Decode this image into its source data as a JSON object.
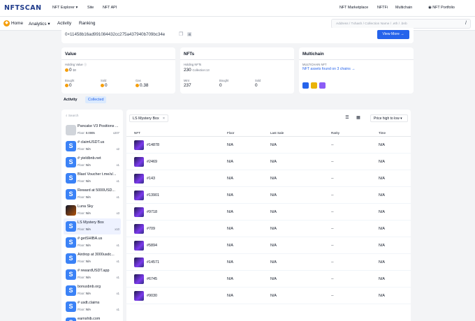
{
  "brand": {
    "logo": "NFTSCAN"
  },
  "topnav": {
    "nft_explorer": "NFT Explorer",
    "site": "Site",
    "nft_api": "NFT API",
    "marketplace": "NFT Marketplace",
    "nftfi": "NFTFi",
    "multichain": "Multichain",
    "portfolio": "NFT Portfolio"
  },
  "subnav": {
    "home": "Home",
    "analytics": "Analytics",
    "activity": "Activity",
    "ranking": "Ranking",
    "search_placeholder": "Address / Txhash / Collection Name / .eth / .bnb",
    "search_slash": "/"
  },
  "address": {
    "value": "0×11458b16ad991084432cc275a437940b709bc34e",
    "view_more": "View More →"
  },
  "value_card": {
    "title": "Value",
    "holding_label": "Holding Value",
    "holding_value": "0",
    "holding_usd": "$0",
    "bought_label": "Bought",
    "bought_value": "0",
    "sold_label": "Sold",
    "sold_value": "0",
    "gas_label": "Gas",
    "gas_value": "0.38"
  },
  "nfts_card": {
    "title": "NFTs",
    "holding_label": "Holding NFTs",
    "holding_count": "230",
    "holding_collections": "Collection:13",
    "mint_label": "Mint",
    "mint_value": "237",
    "bought_label": "Bought",
    "bought_value": "0",
    "sold_label": "Sold",
    "sold_value": "0"
  },
  "multichain_card": {
    "title": "Multichain",
    "label": "MULTICHAIN NFT",
    "link": "NFT assets found on 3 chains →",
    "chain_colors": [
      "#2563eb",
      "#eab308",
      "#8b5cf6"
    ]
  },
  "tabs": {
    "activity": "Activity",
    "collected": "Collected"
  },
  "collections": {
    "search_placeholder": "Search",
    "items": [
      {
        "name": "Pancake V3 Positions ...",
        "floor_label": "Floor:",
        "floor": "0.0005",
        "count": "x207",
        "icon": "image"
      },
      {
        "name": "# claimUSDT.us",
        "floor_label": "Floor:",
        "floor": "N/A",
        "count": "x2",
        "icon": "S"
      },
      {
        "name": "# yieldbnb.net",
        "floor_label": "Floor:",
        "floor": "N/A",
        "count": "x1",
        "icon": "S"
      },
      {
        "name": "Blast Voucher t.me/s/...",
        "floor_label": "Floor:",
        "floor": "N/A",
        "count": "x1",
        "icon": "S"
      },
      {
        "name": "Reward at 5000USD...",
        "floor_label": "Floor:",
        "floor": "N/A",
        "count": "x1",
        "icon": "S"
      },
      {
        "name": "Luna Sky",
        "floor_label": "Floor:",
        "floor": "N/A",
        "count": "x3",
        "icon": "image"
      },
      {
        "name": "LS Mystery Box",
        "floor_label": "Floor:",
        "floor": "N/A",
        "count": "x10",
        "icon": "S"
      },
      {
        "name": "# getSHIBA.us",
        "floor_label": "Floor:",
        "floor": "N/A",
        "count": "x1",
        "icon": "S"
      },
      {
        "name": "Airdrop at 3000usdc...",
        "floor_label": "Floor:",
        "floor": "N/A",
        "count": "x1",
        "icon": "S"
      },
      {
        "name": "# rewardUSDT.app",
        "floor_label": "Floor:",
        "floor": "N/A",
        "count": "x1",
        "icon": "S"
      },
      {
        "name": "bonusbnb.org",
        "floor_label": "Floor:",
        "floor": "N/A",
        "count": "x1",
        "icon": "S"
      },
      {
        "name": "# usdt.claims",
        "floor_label": "Floor:",
        "floor": "N/A",
        "count": "x1",
        "icon": "S"
      },
      {
        "name": "earnshib.com",
        "floor_label": "Floor:",
        "floor": "N/A",
        "count": "x1",
        "icon": "S"
      }
    ]
  },
  "table": {
    "filter_chip": "LS Mystery Box",
    "sort": "Price high to low",
    "headers": {
      "nft": "NFT",
      "floor": "Floor",
      "last_sale": "Last Sale",
      "rarity": "Rarity",
      "time": "Time"
    },
    "rows": [
      {
        "id": "#14878",
        "floor": "N/A",
        "last_sale": "N/A",
        "rarity": "--",
        "time": "N/A"
      },
      {
        "id": "#2469",
        "floor": "N/A",
        "last_sale": "N/A",
        "rarity": "--",
        "time": "N/A"
      },
      {
        "id": "#143",
        "floor": "N/A",
        "last_sale": "N/A",
        "rarity": "--",
        "time": "N/A"
      },
      {
        "id": "#13901",
        "floor": "N/A",
        "last_sale": "N/A",
        "rarity": "--",
        "time": "N/A"
      },
      {
        "id": "#9718",
        "floor": "N/A",
        "last_sale": "N/A",
        "rarity": "--",
        "time": "N/A"
      },
      {
        "id": "#709",
        "floor": "N/A",
        "last_sale": "N/A",
        "rarity": "--",
        "time": "N/A"
      },
      {
        "id": "#5894",
        "floor": "N/A",
        "last_sale": "N/A",
        "rarity": "--",
        "time": "N/A"
      },
      {
        "id": "#14571",
        "floor": "N/A",
        "last_sale": "N/A",
        "rarity": "--",
        "time": "N/A"
      },
      {
        "id": "#6745",
        "floor": "N/A",
        "last_sale": "N/A",
        "rarity": "--",
        "time": "N/A"
      },
      {
        "id": "#9030",
        "floor": "N/A",
        "last_sale": "N/A",
        "rarity": "--",
        "time": "N/A"
      }
    ]
  }
}
